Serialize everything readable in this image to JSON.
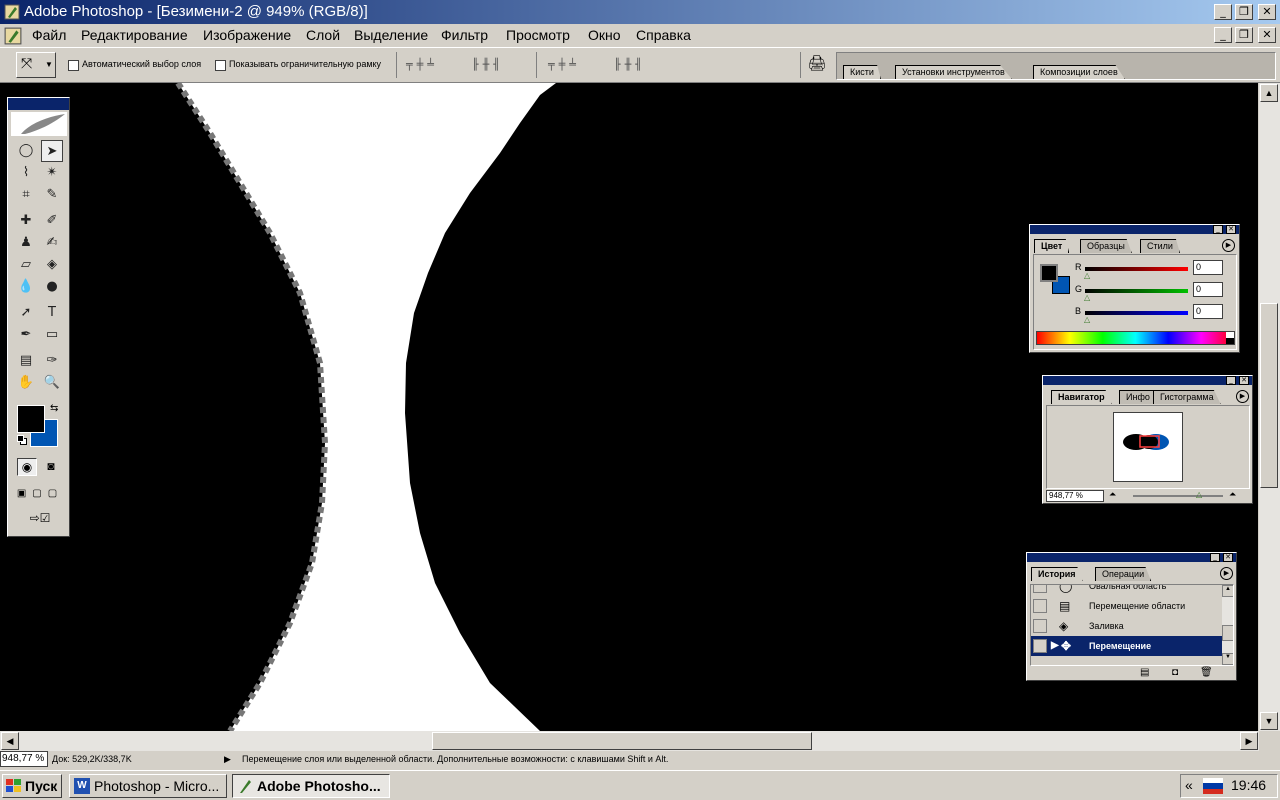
{
  "window": {
    "title": "Adobe Photoshop - [Безимени-2 @ 949% (RGB/8)]",
    "minimize": "_",
    "restore": "❐",
    "close": "✕"
  },
  "menu": {
    "items": [
      "Файл",
      "Редактирование",
      "Изображение",
      "Слой",
      "Выделение",
      "Фильтр",
      "Просмотр",
      "Окно",
      "Справка"
    ]
  },
  "options": {
    "auto_select_label": "Автоматический выбор слоя",
    "show_bounds_label": "Показывать ограничительную рамку",
    "palette_tabs": [
      "Кисти",
      "Установки инструментов",
      "Композиции слоев"
    ]
  },
  "color_panel": {
    "tabs": [
      "Цвет",
      "Образцы",
      "Стили"
    ],
    "channels": [
      {
        "label": "R",
        "value": "0",
        "color": "#ff0000"
      },
      {
        "label": "G",
        "value": "0",
        "color": "#00c000"
      },
      {
        "label": "B",
        "value": "0",
        "color": "#0000ff"
      }
    ],
    "foreground": "#000000",
    "background": "#0055b3"
  },
  "navigator_panel": {
    "tabs": [
      "Навигатор",
      "Инфо",
      "Гистограмма"
    ],
    "zoom": "948,77 %"
  },
  "history_panel": {
    "tabs": [
      "История",
      "Операции"
    ],
    "items": [
      "Овальная область",
      "Перемещение области",
      "Заливка",
      "Перемещение"
    ],
    "active_index": 3
  },
  "status": {
    "zoom": "948,77 %",
    "doc": "Док: 529,2K/338,7K",
    "message": "Перемещение слоя или выделенной области. Дополнительные возможности: с клавишами Shift и Alt."
  },
  "taskbar": {
    "start": "Пуск",
    "tasks": [
      "Photoshop - Micro...",
      "Adobe Photosho..."
    ],
    "tray_arrow": "«",
    "clock": "19:46"
  },
  "colors": {
    "title_start": "#0a246a",
    "title_end": "#a6caf0",
    "chrome": "#d4d0c8",
    "selection": "#0a246a"
  }
}
